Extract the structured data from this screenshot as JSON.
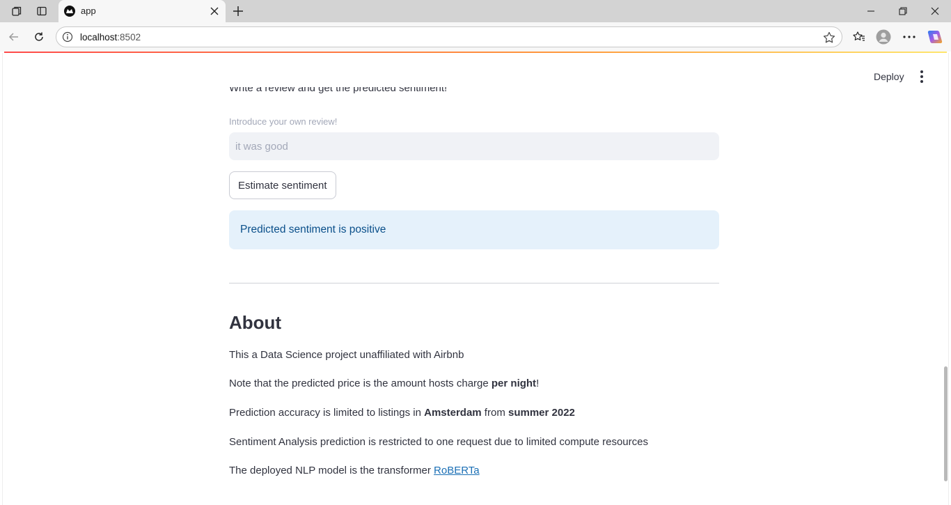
{
  "browser": {
    "tab_title": "app",
    "url_host": "localhost",
    "url_port": ":8502"
  },
  "header": {
    "deploy_label": "Deploy"
  },
  "main": {
    "cut_text": "Write a review and get the predicted sentiment!",
    "review_label": "Introduce your own review!",
    "review_value": "it was good",
    "estimate_button": "Estimate sentiment",
    "result_text": "Predicted sentiment is positive",
    "about_title": "About",
    "about": {
      "line1": "This a Data Science project unaffiliated with Airbnb",
      "line2_a": "Note that the predicted price is the amount hosts charge ",
      "line2_b": "per night",
      "line2_c": "!",
      "line3_a": "Prediction accuracy is limited to listings in ",
      "line3_b": "Amsterdam",
      "line3_c": " from ",
      "line3_d": "summer 2022",
      "line4": "Sentiment Analysis prediction is restricted to one request due to limited compute resources",
      "line5_a": "The deployed NLP model is the transformer ",
      "line5_link": "RoBERTa"
    }
  },
  "icons": [
    "workspaces-icon",
    "tab-actions-icon",
    "app-favicon",
    "tab-close-icon",
    "new-tab-icon",
    "minimize-icon",
    "restore-icon",
    "window-close-icon",
    "back-icon",
    "reload-icon",
    "site-info-icon",
    "favorite-star-icon",
    "favorites-icon",
    "profile-icon",
    "more-icon",
    "copilot-icon",
    "kebab-menu-icon"
  ],
  "colors": {
    "alert_bg": "#e5f1fb",
    "alert_text": "#0a4f8a",
    "link": "#1a6fb5",
    "input_bg": "#f0f2f6"
  }
}
